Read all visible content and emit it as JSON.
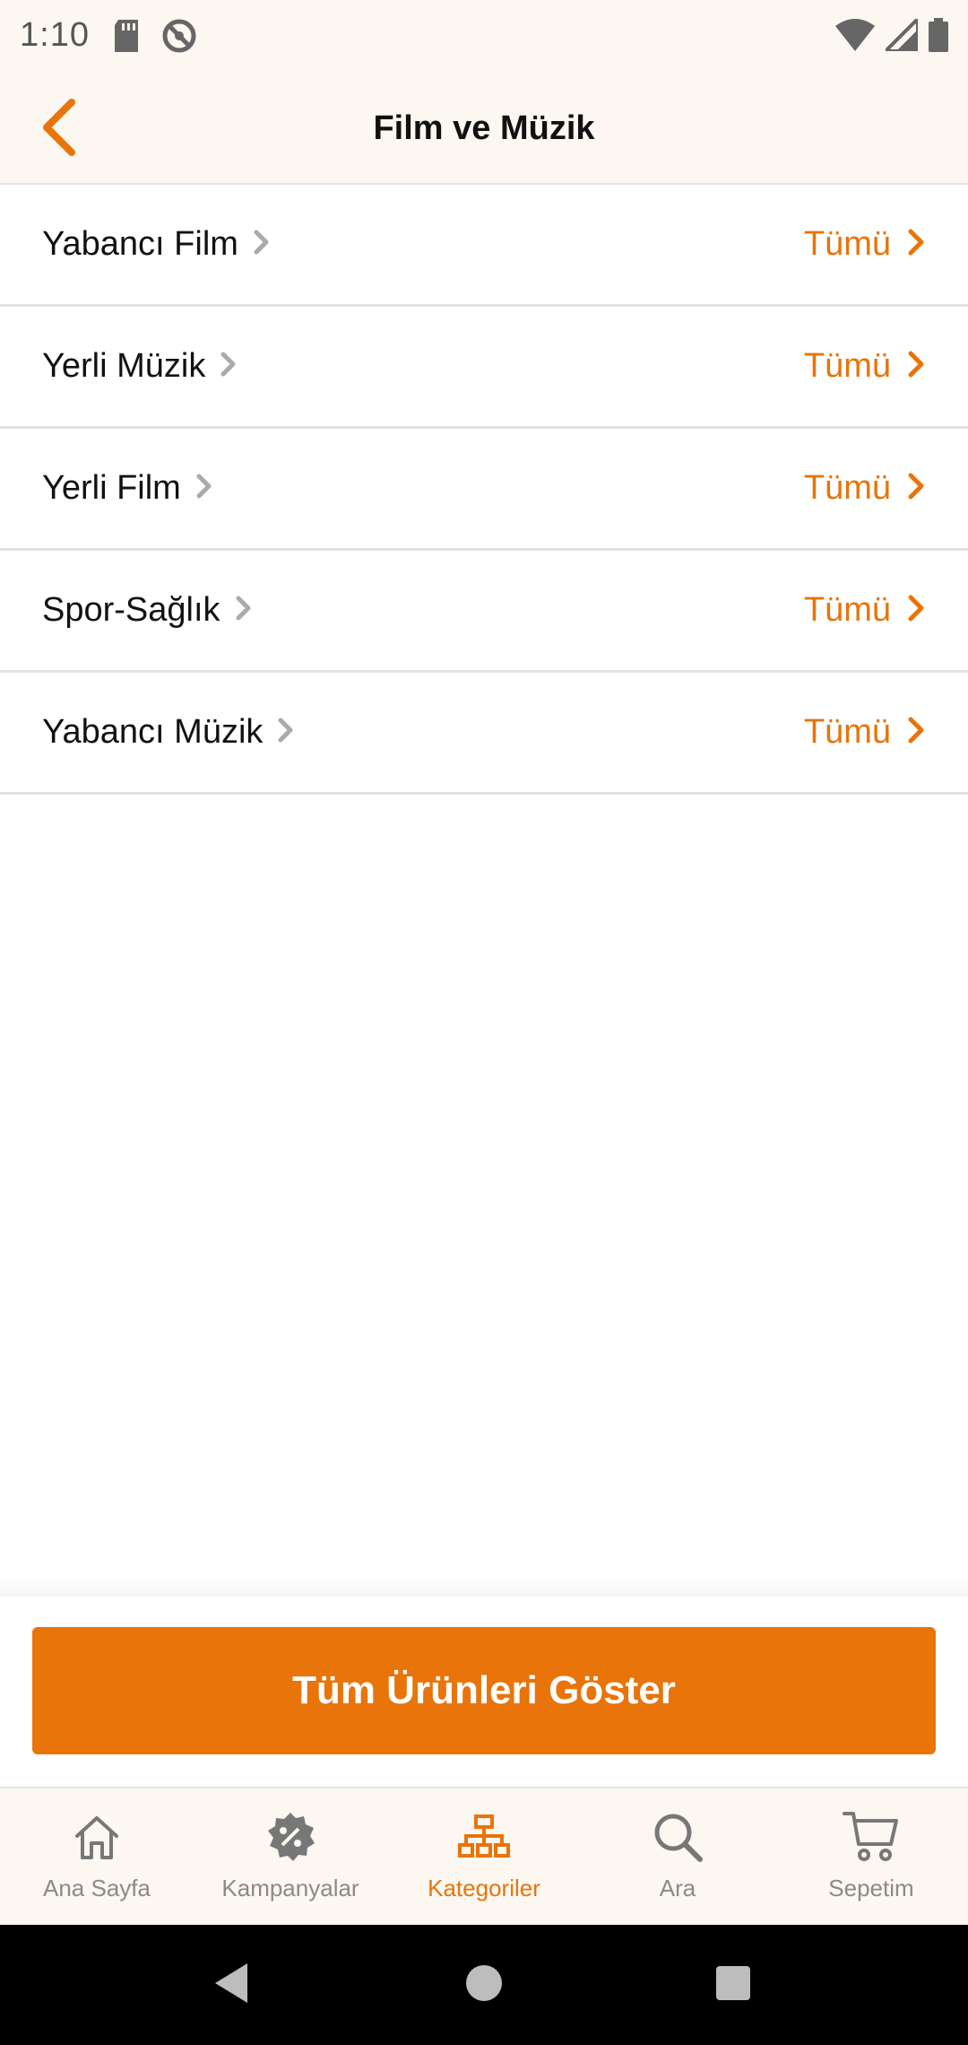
{
  "status_bar": {
    "time": "1:10",
    "icons": [
      "sd-card-icon",
      "do-not-disturb-icon",
      "wifi-icon",
      "signal-icon",
      "battery-icon"
    ]
  },
  "header": {
    "title": "Film ve Müzik",
    "back_icon": "chevron-left-icon"
  },
  "categories": [
    {
      "name": "Yabancı Film",
      "all_label": "Tümü"
    },
    {
      "name": "Yerli Müzik",
      "all_label": "Tümü"
    },
    {
      "name": "Yerli Film",
      "all_label": "Tümü"
    },
    {
      "name": "Spor-Sağlık",
      "all_label": "Tümü"
    },
    {
      "name": "Yabancı Müzik",
      "all_label": "Tümü"
    }
  ],
  "footer": {
    "show_all_label": "Tüm Ürünleri Göster"
  },
  "bottom_nav": {
    "items": [
      {
        "label": "Ana Sayfa",
        "icon": "home-icon",
        "active": false
      },
      {
        "label": "Kampanyalar",
        "icon": "discount-badge-icon",
        "active": false
      },
      {
        "label": "Kategoriler",
        "icon": "category-tree-icon",
        "active": true
      },
      {
        "label": "Ara",
        "icon": "search-icon",
        "active": false
      },
      {
        "label": "Sepetim",
        "icon": "cart-icon",
        "active": false
      }
    ]
  },
  "colors": {
    "accent": "#e8740a",
    "header_bg": "#fcf7f0",
    "divider": "#e2e2e2"
  }
}
